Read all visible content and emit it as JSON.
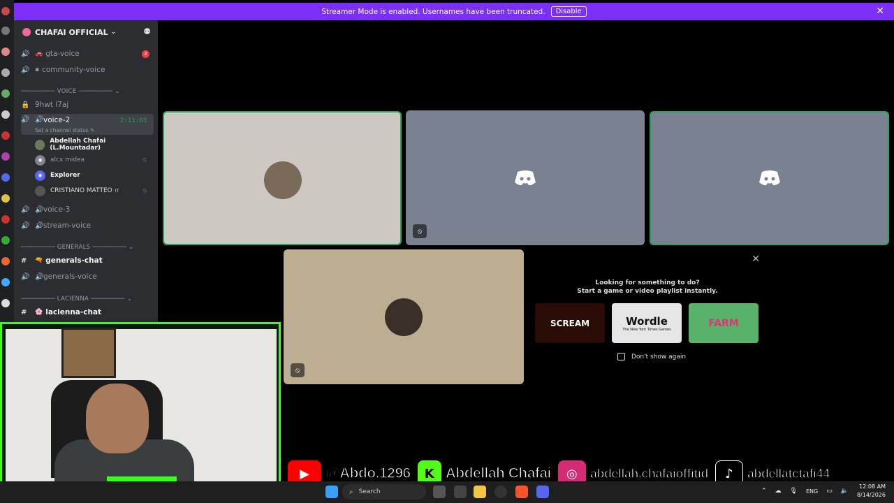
{
  "banner": {
    "message": "Streamer Mode is enabled. Usernames have been truncated.",
    "disable_label": "Disable"
  },
  "server": {
    "name": "CHAFAI OFFICIAL"
  },
  "channels": {
    "gta_voice": {
      "label": "gta-voice",
      "badge": "2"
    },
    "community_voice": {
      "label": "community-voice"
    },
    "cat_voice": "VOICE",
    "locked": {
      "label": "9hwt l7aj"
    },
    "voice2": {
      "label": "voice-2",
      "timer": "2:11:03",
      "status": "Set a channel status"
    },
    "voice3": {
      "label": "voice-3"
    },
    "stream_voice": {
      "label": "stream-voice"
    },
    "cat_generals": "GENERALS",
    "generals_chat": {
      "label": "generals-chat"
    },
    "generals_voice": {
      "label": "generals-voice"
    },
    "cat_lacienna": "LACIENNA",
    "lacienna_chat": {
      "label": "lacienna-chat"
    }
  },
  "members": [
    {
      "name": "Abdellah Chafai (L.Mountadar)"
    },
    {
      "name": "alcx midea"
    },
    {
      "name": "Explorer"
    },
    {
      "name": "CRISTIANO MATTEO",
      "suffix": "IT"
    }
  ],
  "activity": {
    "line1": "Looking for something to do?",
    "line2": "Start a game or video playlist instantly.",
    "games": [
      "SCREAM",
      "Wordle",
      "FARM"
    ],
    "wordle_sub": "The New York Times Games",
    "dont_show": "Don't show again"
  },
  "social": {
    "youtube": "@Abdo.1296",
    "kick": "Abdellah Chafai",
    "instagram": "abdellah.chafaioffitid",
    "tiktok": "abdellatctafi44"
  },
  "taskbar": {
    "search_label": "Search",
    "lang": "ENG",
    "time": "12:08 AM",
    "date": "8/14/2026"
  },
  "colors": {
    "banner": "#7b2ff7",
    "speaking": "#23a55a",
    "webcam_border": "#39ff14"
  }
}
